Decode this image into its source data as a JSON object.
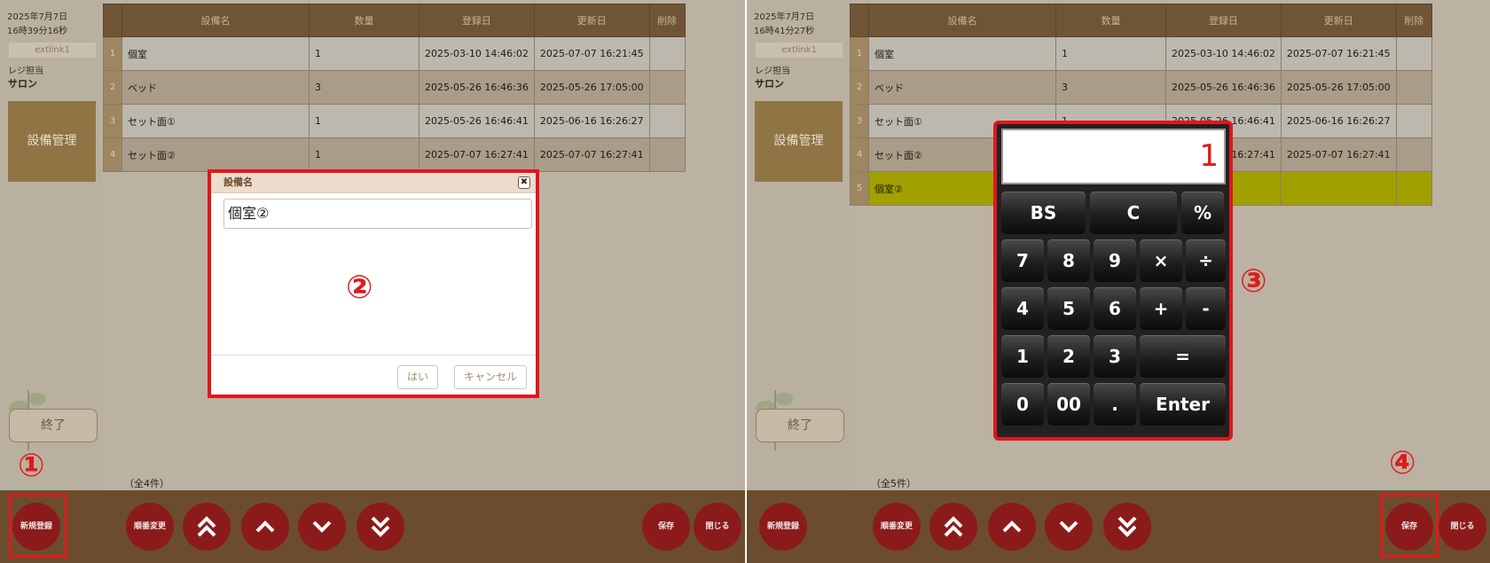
{
  "panels": [
    {
      "datetime_date": "2025年7月7日",
      "datetime_time": "16時39分16秒",
      "extlink": "extlink1",
      "regi_label": "レジ担当",
      "regi_value": "サロン",
      "mgmt_button": "設備管理",
      "end_button": "終了",
      "count": "（全4件）",
      "buttons": {
        "new": "新規登録",
        "reorder": "順番変更",
        "save": "保存",
        "close": "閉じる"
      }
    },
    {
      "datetime_date": "2025年7月7日",
      "datetime_time": "16時41分27秒",
      "extlink": "extlink1",
      "regi_label": "レジ担当",
      "regi_value": "サロン",
      "mgmt_button": "設備管理",
      "end_button": "終了",
      "count": "（全5件）",
      "buttons": {
        "new": "新規登録",
        "reorder": "順番変更",
        "save": "保存",
        "close": "閉じる"
      }
    }
  ],
  "table": {
    "headers": [
      "設備名",
      "数量",
      "登録日",
      "更新日",
      "削除"
    ],
    "rows": [
      {
        "no": "1",
        "name": "個室",
        "qty": "1",
        "registered": "2025-03-10 14:46:02",
        "updated": "2025-07-07 16:21:45"
      },
      {
        "no": "2",
        "name": "ベッド",
        "qty": "3",
        "registered": "2025-05-26 16:46:36",
        "updated": "2025-05-26 17:05:00"
      },
      {
        "no": "3",
        "name": "セット面①",
        "qty": "1",
        "registered": "2025-05-26 16:46:41",
        "updated": "2025-06-16 16:26:27"
      },
      {
        "no": "4",
        "name": "セット面②",
        "qty": "1",
        "registered": "2025-07-07 16:27:41",
        "updated": "2025-07-07 16:27:41"
      }
    ],
    "new_row": {
      "no": "5",
      "name": "個室②"
    }
  },
  "dialog": {
    "title": "設備名",
    "close_glyph": "✖",
    "input_value": "個室②",
    "ok": "はい",
    "cancel": "キャンセル"
  },
  "calculator": {
    "display": "1",
    "keys": {
      "bs": "BS",
      "c": "C",
      "pct": "%",
      "k7": "7",
      "k8": "8",
      "k9": "9",
      "mul": "×",
      "div": "÷",
      "k4": "4",
      "k5": "5",
      "k6": "6",
      "plus": "+",
      "minus": "-",
      "k1": "1",
      "k2": "2",
      "k3": "3",
      "eq": "=",
      "k0": "0",
      "k00": "00",
      "dot": ".",
      "enter": "Enter"
    }
  },
  "annotations": {
    "m1": "①",
    "m2": "②",
    "m3": "③",
    "m4": "④"
  },
  "colors": {
    "annotation_red": "#e01a1a",
    "round_button": "#8b1b1b",
    "bottom_bar": "#6b4d2e",
    "highlight_row": "#a0a100"
  },
  "icons": [
    "double-chevron-up-icon",
    "chevron-up-icon",
    "chevron-down-icon",
    "double-chevron-down-icon",
    "close-icon"
  ]
}
